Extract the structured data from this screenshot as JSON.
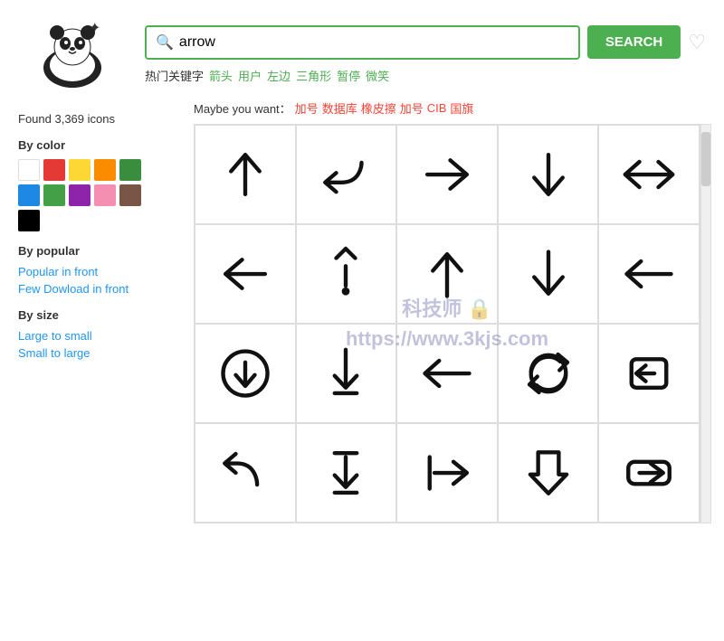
{
  "header": {
    "search_placeholder": "arrow",
    "search_value": "arrow",
    "search_button_label": "SEARCH",
    "hot_label": "热门关键字",
    "hot_keywords": [
      "箭头",
      "用户",
      "左边",
      "三角形",
      "暂停",
      "微笑"
    ],
    "maybe_label": "Maybe you want：",
    "maybe_keywords": [
      "加号",
      "数据库",
      "橡皮擦",
      "加号",
      "CIB",
      "国旗"
    ]
  },
  "sidebar": {
    "found_text": "Found 3,369 icons",
    "by_color_label": "By color",
    "colors": [
      {
        "hex": "#ffffff",
        "name": "white"
      },
      {
        "hex": "#e53935",
        "name": "red"
      },
      {
        "hex": "#fdd835",
        "name": "yellow"
      },
      {
        "hex": "#fb8c00",
        "name": "orange"
      },
      {
        "hex": "#388e3c",
        "name": "green"
      },
      {
        "hex": "#1e88e5",
        "name": "blue"
      },
      {
        "hex": "#43a047",
        "name": "light-green"
      },
      {
        "hex": "#8e24aa",
        "name": "purple"
      },
      {
        "hex": "#f48fb1",
        "name": "pink"
      },
      {
        "hex": "#795548",
        "name": "brown"
      },
      {
        "hex": "#000000",
        "name": "black"
      }
    ],
    "by_popular_label": "By popular",
    "popular_links": [
      {
        "label": "Popular in front",
        "href": "#"
      },
      {
        "label": "Few Dowload in front",
        "href": "#"
      }
    ],
    "by_size_label": "By size",
    "size_links": [
      {
        "label": "Large to small",
        "href": "#"
      },
      {
        "label": "Small to large",
        "href": "#"
      }
    ]
  },
  "watermark": {
    "line1": "科技师 🔒",
    "line2": "https://www.3kjs.com"
  },
  "icons": [
    {
      "symbol": "↑",
      "desc": "up arrow"
    },
    {
      "symbol": "↩",
      "desc": "return arrow"
    },
    {
      "symbol": "→",
      "desc": "right arrow"
    },
    {
      "symbol": "↓",
      "desc": "down arrow"
    },
    {
      "symbol": "↔",
      "desc": "left-right arrow"
    },
    {
      "symbol": "←",
      "desc": "left arrow"
    },
    {
      "symbol": "↕",
      "desc": "up-down arrow with dot"
    },
    {
      "symbol": "↑",
      "desc": "up arrow 2"
    },
    {
      "symbol": "↓",
      "desc": "down arrow 2"
    },
    {
      "symbol": "←",
      "desc": "left arrow long"
    },
    {
      "symbol": "⬇",
      "desc": "down circle arrow"
    },
    {
      "symbol": "↓",
      "desc": "down arrow 3"
    },
    {
      "symbol": "←",
      "desc": "left arrow 2"
    },
    {
      "symbol": "🔄",
      "desc": "refresh arrows"
    },
    {
      "symbol": "⬅",
      "desc": "exit arrow"
    },
    {
      "symbol": "↩",
      "desc": "undo arrow"
    },
    {
      "symbol": "↓",
      "desc": "down with line"
    },
    {
      "symbol": "↦",
      "desc": "right from bar"
    },
    {
      "symbol": "⬇",
      "desc": "down chunky"
    },
    {
      "symbol": "➡",
      "desc": "right chunky"
    }
  ]
}
